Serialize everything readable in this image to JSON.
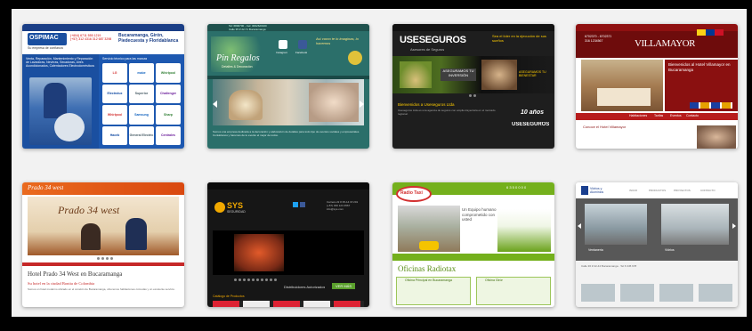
{
  "colors": {
    "background": "#f2f2f2",
    "frame": "#000000",
    "ospimac_blue": "#1a4fa0",
    "pinregalos_teal": "#2b6f6a",
    "useseguros_dark": "#2a2a2a",
    "villamayor_red": "#a31515",
    "prado_orange": "#e35b1b",
    "sys_dark": "#111111",
    "radiotax_green": "#74b01c",
    "vidrios_gray": "#5a5a5a"
  },
  "cards": {
    "ospimac": {
      "logo": "OSPIMAC",
      "tagline": "Su empresa de confianza",
      "phones": "(+604) 6711  555 1219\n(+57) 312 4316  312 687 3298",
      "city": "Bucaramanga, Girón, Piedecuesta y Floridablanca",
      "left_text": "Venta, Reparación, Mantenimiento y Reparación de Lavadoras, Neveras, Secadoras, Aires Acondicionados, Calentadores Electrodomésticos",
      "right_header": "Servicio técnico para las marcas",
      "brands": [
        "LG",
        "mabe",
        "Whirlpool",
        "Electrolux",
        "Superior",
        "Challenger",
        "Whirlpool",
        "Samsung",
        "Sharp",
        "Haceb",
        "General Electric",
        "Centrales"
      ]
    },
    "pinregalos": {
      "header_text": "Tel: 6800700 - Cel: 3002620100\nCalle 35 # 22-71 Bucaramanga",
      "logo": "Pin Regalos",
      "logo_sub": "Detalles & Decoración",
      "icon_labels": [
        "Instagram",
        "Facebook"
      ],
      "promo": "Así como te lo imaginas, lo hacemos",
      "body_text": "Somos una empresa dedicada a la decoración y elaboración de detalles para todo tipo de eventos sociales y empresariales. Contáctanos y haremos de tu evento el mejor de todos."
    },
    "useseguros": {
      "logo": "USESEGUROS",
      "logo_sub": "Asesores de Seguros",
      "tag": "Sea el líder en la ejecución de sus sueños",
      "banner_left": "ASEGURAMOS TU INVERSIÓN",
      "banner_right": "ASEGURAMOS TU BIENESTAR",
      "section": "Bienvenidos a Useseguros Ltda",
      "body": "Useseguros Ltda es una agencia de seguros con amplia trayectoria en el mercado regional.",
      "badge_years": "10 años",
      "badge_logo": "USESEGUROS"
    },
    "villamayor": {
      "phones": "6702370 - 6702371\n316 1234567",
      "logo": "VILLAMAYOR",
      "welcome": "Bienvenidos al Hotel Villamayor en Bucaramanga",
      "links": [
        "Habitaciones",
        "Tarifas",
        "Eventos",
        "Contacto"
      ],
      "footer_title": "Conoce el Hotel Villamayor"
    },
    "prado": {
      "logo": "Prado 34 west",
      "title": "Hotel Prado 34 West en Bucaramanga",
      "subtitle": "Su hotel en la ciudad Bonita de Colombia",
      "body": "Somos un hotel moderno ubicado en el corazón de Bucaramanga, ofrecemos habitaciones cómodas y un excelente servicio."
    },
    "sys": {
      "logo": "SYS",
      "logo_sub": "SEGURIDAD",
      "contact": "Carrera 22 # 35-14 Of 201\n(+57) 300 123 4567\ninfo@sys.com",
      "side_label": "Distribuidores Autorizados",
      "side_button": "VER MÁS",
      "catalog": "Catálogo de Productos"
    },
    "radiotax": {
      "logo": "Radio Taxi",
      "phone": "6 3 5 0 0 0 0",
      "slogan": "Un Equipo humano comprometido con usted",
      "offices_title": "Oficinas Radiotax",
      "office_a": "Oficina Principal en Bucaramanga",
      "office_b": "Oficina Girón"
    },
    "vidrios": {
      "logo": "Vidrios y Aluminios",
      "nav": [
        "INICIO",
        "PRODUCTOS",
        "PROYECTOS",
        "CONTACTO"
      ],
      "caption_a": "Ventaneria",
      "caption_b": "Vidrios",
      "footer": "Calle 36 # 22-44 Bucaramanga · Tel 6 345 678"
    }
  }
}
